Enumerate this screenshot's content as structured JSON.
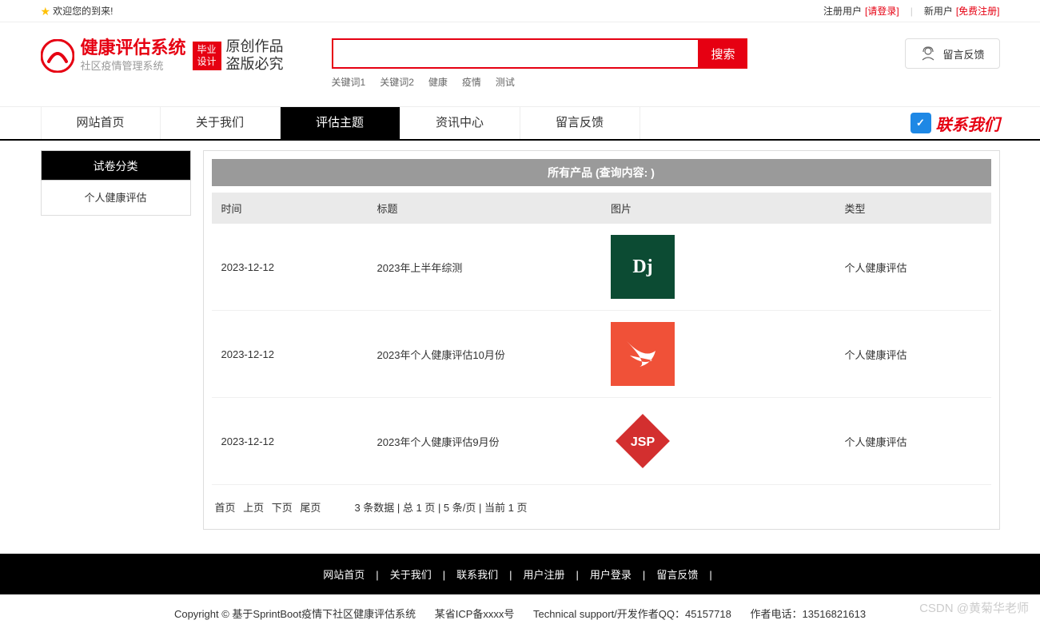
{
  "topbar": {
    "welcome": "欢迎您的到来!",
    "registered_user": "注册用户",
    "login_link": "[请登录]",
    "new_user": "新用户",
    "register_link": "[免费注册]"
  },
  "header": {
    "logo_title": "健康评估系统",
    "logo_sub": "社区疫情管理系统",
    "badge_line1": "毕业",
    "badge_line2": "设计",
    "badge_text1": "原创作品",
    "badge_text2": "盗版必究",
    "search_btn": "搜索",
    "keywords": [
      "关键词1",
      "关键词2",
      "健康",
      "疫情",
      "测试"
    ],
    "feedback": "留言反馈"
  },
  "nav": {
    "items": [
      "网站首页",
      "关于我们",
      "评估主题",
      "资讯中心",
      "留言反馈"
    ],
    "active_index": 2,
    "contact": "联系我们"
  },
  "sidebar": {
    "head": "试卷分类",
    "items": [
      "个人健康评估"
    ]
  },
  "content": {
    "head": "所有产品 (查询内容:  )",
    "cols": [
      "时间",
      "标题",
      "图片",
      "类型"
    ],
    "rows": [
      {
        "date": "2023-12-12",
        "title": "2023年上半年综测",
        "img": "dj",
        "type": "个人健康评估"
      },
      {
        "date": "2023-12-12",
        "title": "2023年个人健康评估10月份",
        "img": "swift",
        "type": "个人健康评估"
      },
      {
        "date": "2023-12-12",
        "title": "2023年个人健康评估9月份",
        "img": "jsp",
        "type": "个人健康评估"
      }
    ]
  },
  "pager": {
    "first": "首页",
    "prev": "上页",
    "next": "下页",
    "last": "尾页",
    "info": "3 条数据 | 总 1 页 | 5 条/页 | 当前 1 页"
  },
  "footer": {
    "links": [
      "网站首页",
      "关于我们",
      "联系我们",
      "用户注册",
      "用户登录",
      "留言反馈"
    ],
    "copyright": "Copyright © 基于SprintBoot疫情下社区健康评估系统",
    "icp": "某省ICP备xxxx号",
    "tech": "Technical support/开发作者QQ：45157718",
    "author": "作者电话：13516821613"
  },
  "watermark": "CSDN @黄菊华老师"
}
